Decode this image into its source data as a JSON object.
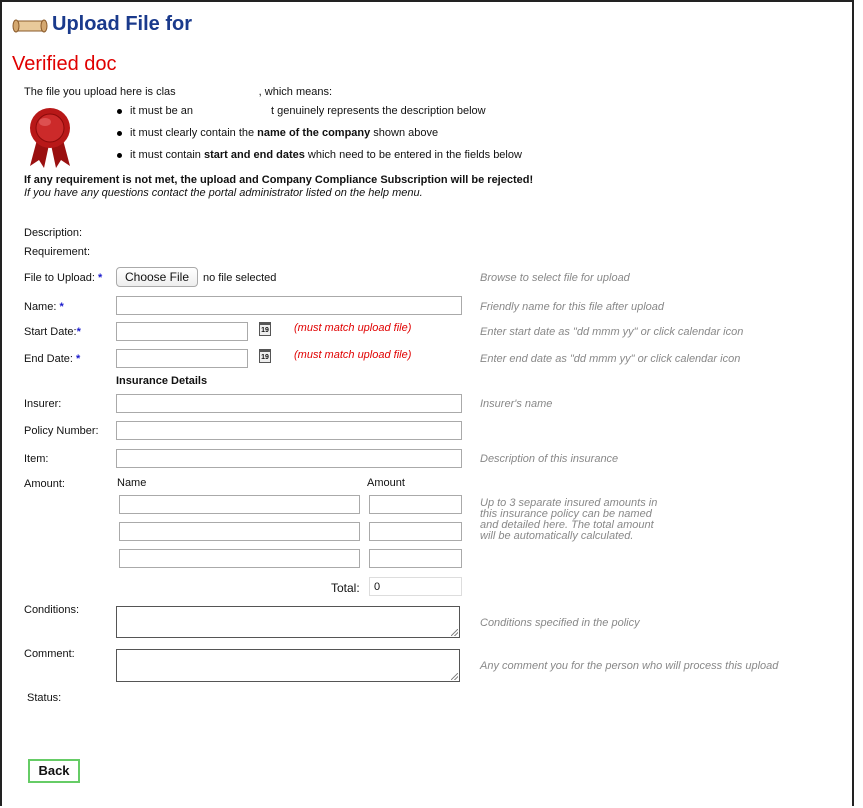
{
  "header": {
    "title": "Upload File for"
  },
  "verified": {
    "heading": "Verified doc"
  },
  "intro": {
    "text_start": "The file you upload here is clas",
    "text_end": ", which means:",
    "bullet1_start": "it must be an",
    "bullet1_end": "t genuinely represents the description below",
    "bullet2_pre": "it must clearly contain the ",
    "bullet2_bold": "name of the company",
    "bullet2_post": " shown above",
    "bullet3_pre": "it must contain ",
    "bullet3_bold": "start and end dates",
    "bullet3_post": " which need to be entered in the fields below"
  },
  "warning": {
    "bold": "If any requirement is not met, the upload and Company Compliance Subscription will be rejected!",
    "italic": "If you have any questions contact the portal administrator listed on the help menu."
  },
  "form": {
    "description_label": "Description:",
    "requirement_label": "Requirement:",
    "file_label": "File to Upload:",
    "required_marker": "*",
    "choose_file_label": "Choose File",
    "no_file_text": "no file selected",
    "file_hint": "Browse to select file for upload",
    "name_label": "Name:",
    "name_value": "",
    "name_hint": "Friendly name for this file after upload",
    "start_label": "Start Date:",
    "start_value": "",
    "start_note": "(must match upload file)",
    "start_hint": "Enter start date as \"dd mmm yy\" or click calendar icon",
    "end_label": "End Date:",
    "end_value": "",
    "end_note": "(must match upload file)",
    "end_hint": "Enter end date as \"dd mmm yy\" or click calendar icon",
    "calendar_text": "19",
    "insurance_heading": "Insurance Details",
    "insurer_label": "Insurer:",
    "insurer_value": "",
    "insurer_hint": "Insurer's name",
    "policy_label": "Policy Number:",
    "policy_value": "",
    "item_label": "Item:",
    "item_value": "",
    "item_hint": "Description of this insurance",
    "amount_label": "Amount:",
    "amount_name_header": "Name",
    "amount_amount_header": "Amount",
    "amount_hint_lines": [
      "Up to 3 separate insured amounts in",
      "this insurance policy can be named",
      "and detailed here. The total amount",
      "will be automatically calculated."
    ],
    "total_label": "Total:",
    "total_value": "0",
    "conditions_label": "Conditions:",
    "conditions_hint": "Conditions specified in the policy",
    "comment_label": "Comment:",
    "comment_hint": "Any comment you for the person who will process this upload",
    "status_label": "Status:"
  },
  "footer": {
    "back_label": "Back"
  },
  "colors": {
    "title": "#1a3a8c",
    "verified": "#e00000",
    "required_star": "#1a1acc",
    "hint": "#888888",
    "back_border": "#66cc66"
  },
  "icons": {
    "header": "scroll-icon",
    "seal": "ribbon-seal-icon",
    "calendar": "calendar-icon"
  }
}
